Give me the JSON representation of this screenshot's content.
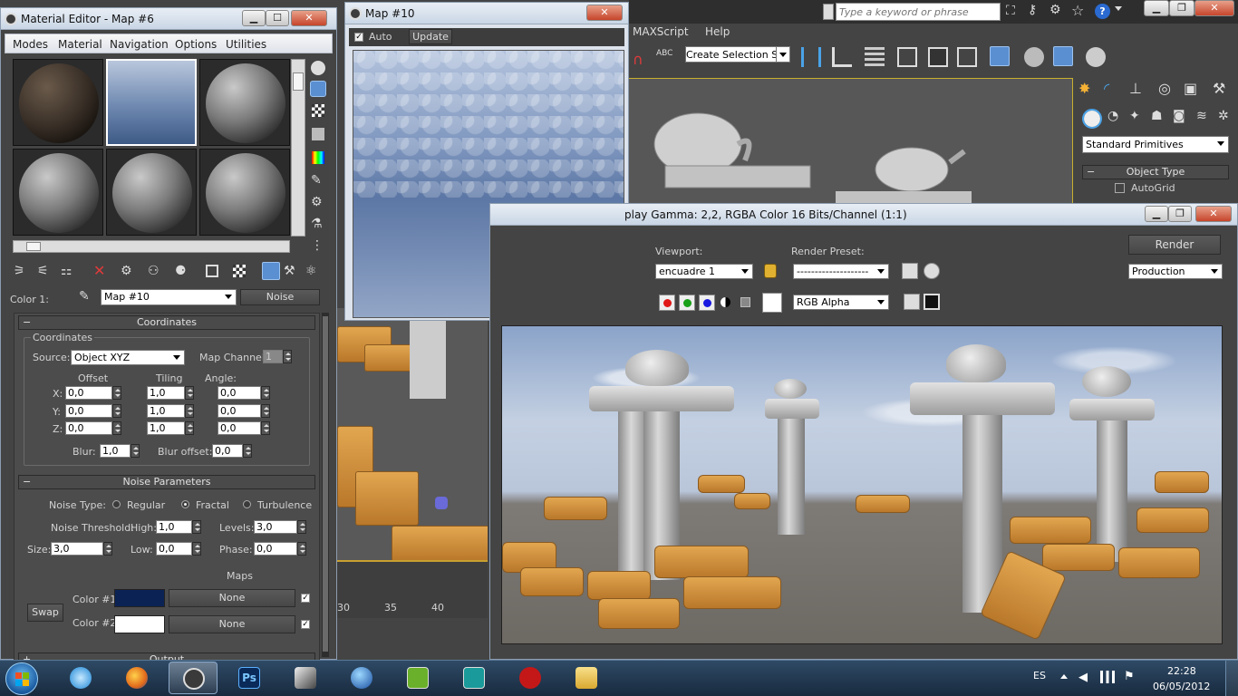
{
  "max": {
    "search_placeholder": "Type a keyword or phrase",
    "menu": [
      "MAXScript",
      "Help"
    ],
    "selection_set_placeholder": "Create Selection Se",
    "panel": {
      "dropdown": "Standard Primitives",
      "object_type": "Object Type",
      "autogrid": "AutoGrid"
    },
    "timeline_ticks": [
      "30",
      "35",
      "40"
    ]
  },
  "material_editor": {
    "title": "Material Editor - Map #6",
    "menu": [
      "Modes",
      "Material",
      "Navigation",
      "Options",
      "Utilities"
    ],
    "color_label": "Color 1:",
    "map_name": "Map #10",
    "map_type": "Noise",
    "coords": {
      "header": "Coordinates",
      "group": "Coordinates",
      "source_label": "Source:",
      "source_value": "Object XYZ",
      "channel_label": "Map Channel:",
      "channel_value": "1",
      "offset": "Offset",
      "tiling": "Tiling",
      "angle": "Angle:",
      "x": "X:",
      "y": "Y:",
      "z": "Z:",
      "offset_x": "0,0",
      "offset_y": "0,0",
      "offset_z": "0,0",
      "tiling_x": "1,0",
      "tiling_y": "1,0",
      "tiling_z": "1,0",
      "angle_x": "0,0",
      "angle_y": "0,0",
      "angle_z": "0,0",
      "blur_label": "Blur:",
      "blur": "1,0",
      "blur_offset_label": "Blur offset:",
      "blur_offset": "0,0"
    },
    "noise": {
      "header": "Noise Parameters",
      "type_label": "Noise Type:",
      "regular": "Regular",
      "fractal": "Fractal",
      "turbulence": "Turbulence",
      "threshold_label": "Noise Threshold:",
      "high_label": "High:",
      "high": "1,0",
      "levels_label": "Levels:",
      "levels": "3,0",
      "size_label": "Size:",
      "size": "3,0",
      "low_label": "Low:",
      "low": "0,0",
      "phase_label": "Phase:",
      "phase": "0,0",
      "maps_label": "Maps",
      "color1_label": "Color #1",
      "color2_label": "Color #2",
      "color1_map": "None",
      "color2_map": "None",
      "swap": "Swap",
      "color1": "#0b2354",
      "color2": "#ffffff"
    },
    "output_header": "Output"
  },
  "map_preview": {
    "title": "Map #10",
    "auto_label": "Auto",
    "update_label": "Update"
  },
  "render_frame": {
    "title": "play Gamma: 2,2, RGBA Color 16 Bits/Channel (1:1)",
    "viewport_label": "Viewport:",
    "viewport_value": "encuadre 1",
    "preset_label": "Render Preset:",
    "preset_value": "--------------------",
    "render_button": "Render",
    "production_value": "Production",
    "channel_value": "RGB Alpha"
  },
  "taskbar": {
    "language": "ES",
    "time": "22:28",
    "date": "06/05/2012",
    "apps": [
      "start-orb",
      "itunes",
      "firefox",
      "3ds-max",
      "photoshop",
      "inkscape",
      "browser-globe",
      "autocad-1",
      "autocad-2",
      "sbx",
      "explorer"
    ]
  }
}
